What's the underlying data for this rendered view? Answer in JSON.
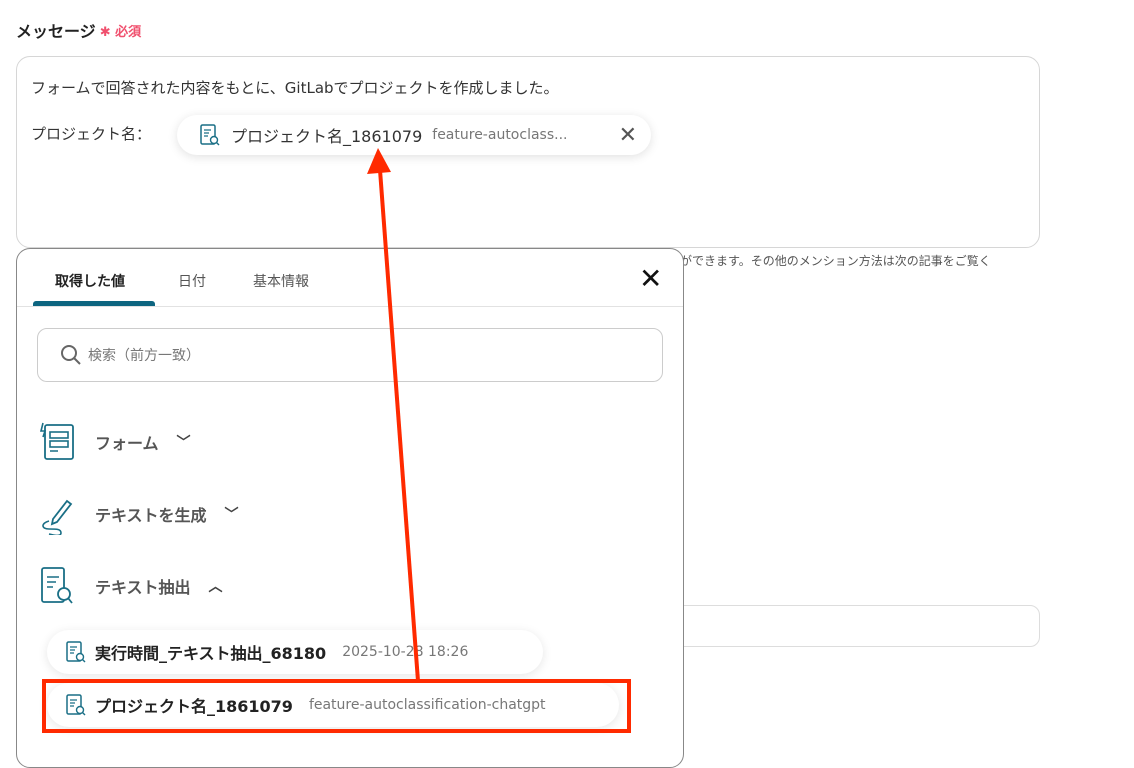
{
  "field": {
    "label": "メッセージ",
    "required": "必須",
    "line1": "フォームで回答された内容をもとに、GitLabでプロジェクトを作成しました。",
    "line2": "プロジェクト名：",
    "chip_name": "プロジェクト名_1861079",
    "chip_value": "feature-autoclass..."
  },
  "help_text": "ができます。その他のメンション方法は次の記事をご覧く",
  "popup": {
    "tabs": [
      "取得した値",
      "日付",
      "基本情報"
    ],
    "search_placeholder": "検索（前方一致）",
    "sections": [
      "フォーム",
      "テキストを生成",
      "テキスト抽出"
    ],
    "items": [
      {
        "name": "実行時間_テキスト抽出_68180",
        "value": "2025-10-28 18:26"
      },
      {
        "name": "プロジェクト名_1861079",
        "value": "feature-autoclassification-chatgpt"
      }
    ]
  },
  "colors": {
    "accent": "#0d6580",
    "annotation": "#ff2a00",
    "required": "#f0506e"
  }
}
